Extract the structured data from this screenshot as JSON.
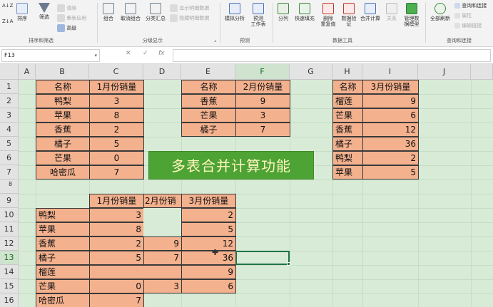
{
  "ribbon": {
    "sort_az": "A↓Z",
    "sort_za": "Z↓A",
    "sort": "排序",
    "filter": "筛选",
    "clear": "清除",
    "reapply": "重新应用",
    "advanced": "高级",
    "group_sort_filter": "排序和筛选",
    "group": "组合",
    "ungroup": "取消组合",
    "subtotal": "分类汇总",
    "show_detail": "显示明细数据",
    "hide_detail": "隐藏明细数据",
    "group_outline": "分级显示",
    "whatif": "模拟分析",
    "forecast_sheet": "预测\n工作表",
    "group_forecast": "预测",
    "text_to_columns": "分列",
    "flash_fill": "快速填充",
    "remove_dup": "删除\n重复值",
    "validation": "数据验\n证",
    "consolidate": "合并计算",
    "relations": "关系",
    "manage_model": "管理数\n据模型",
    "group_data_tools": "数据工具",
    "refresh_all": "全部刷新",
    "queries": "查询和连接",
    "properties": "属性",
    "edit_links": "编辑链接",
    "group_queries": "查询和连接"
  },
  "formula_bar": {
    "name_box": "F13",
    "cancel": "✕",
    "enter": "✓",
    "fx": "fx",
    "value": ""
  },
  "columns": [
    "A",
    "B",
    "C",
    "D",
    "E",
    "F",
    "G",
    "H",
    "I",
    "J"
  ],
  "rows": [
    "1",
    "2",
    "3",
    "4",
    "5",
    "6",
    "7",
    "8",
    "9",
    "10",
    "11",
    "12",
    "13",
    "14",
    "15",
    "16"
  ],
  "table1": {
    "h_name": "名称",
    "h_sales": "1月份销量",
    "r1_name": "鸭梨",
    "r1_val": "3",
    "r2_name": "苹果",
    "r2_val": "8",
    "r3_name": "香蕉",
    "r3_val": "2",
    "r4_name": "橘子",
    "r4_val": "5",
    "r5_name": "芒果",
    "r5_val": "0",
    "r6_name": "哈密瓜",
    "r6_val": "7"
  },
  "table2": {
    "h_name": "名称",
    "h_sales": "2月份销量",
    "r1_name": "香蕉",
    "r1_val": "9",
    "r2_name": "芒果",
    "r2_val": "3",
    "r3_name": "橘子",
    "r3_val": "7"
  },
  "table3": {
    "h_name": "名称",
    "h_sales": "3月份销量",
    "r1_name": "榴莲",
    "r1_val": "9",
    "r2_name": "芒果",
    "r2_val": "6",
    "r3_name": "香蕉",
    "r3_val": "12",
    "r4_name": "橘子",
    "r4_val": "36",
    "r5_name": "鸭梨",
    "r5_val": "2",
    "r6_name": "苹果",
    "r6_val": "5"
  },
  "banner": "多表合并计算功能",
  "result": {
    "h_m1": "1月份销量",
    "h_m2": "2月份销",
    "h_m3": "3月份销量",
    "r1_name": "鸭梨",
    "r1_m1": "3",
    "r1_m2": "",
    "r1_m3": "2",
    "r2_name": "苹果",
    "r2_m1": "8",
    "r2_m2": "",
    "r2_m3": "5",
    "r3_name": "香蕉",
    "r3_m1": "2",
    "r3_m2": "9",
    "r3_m3": "12",
    "r4_name": "橘子",
    "r4_m1": "5",
    "r4_m2": "7",
    "r4_m3": "36",
    "r5_name": "榴莲",
    "r5_m1": "",
    "r5_m2": "",
    "r5_m3": "9",
    "r6_name": "芒果",
    "r6_m1": "0",
    "r6_m2": "3",
    "r6_m3": "6",
    "r7_name": "哈密瓜",
    "r7_m1": "7"
  },
  "colors": {
    "cell_fill": "#f4b18e",
    "sheet_bg": "#d8ebd6",
    "banner_bg": "#4ea335",
    "banner_text": "#fff6c0",
    "selection": "#217346"
  }
}
